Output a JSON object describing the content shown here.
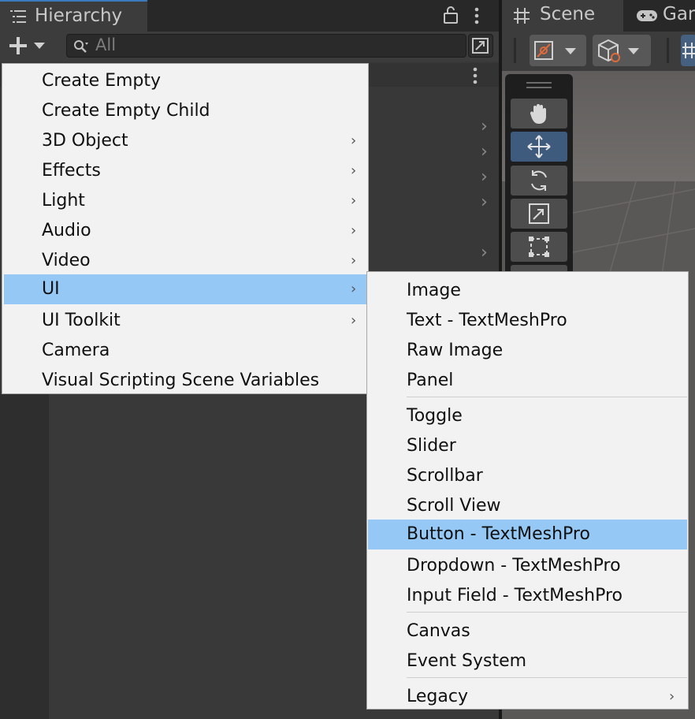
{
  "hierarchy": {
    "tab_title": "Hierarchy",
    "search_placeholder": "All"
  },
  "scene": {
    "tab_title": "Scene",
    "game_tab_title": "Gam"
  },
  "create_menu": {
    "items": [
      {
        "label": "Create Empty",
        "submenu": false
      },
      {
        "label": "Create Empty Child",
        "submenu": false
      },
      {
        "label": "3D Object",
        "submenu": true
      },
      {
        "label": "Effects",
        "submenu": true
      },
      {
        "label": "Light",
        "submenu": true
      },
      {
        "label": "Audio",
        "submenu": true
      },
      {
        "label": "Video",
        "submenu": true
      },
      {
        "label": "UI",
        "submenu": true,
        "highlighted": true
      },
      {
        "label": "UI Toolkit",
        "submenu": true
      },
      {
        "label": "Camera",
        "submenu": false
      },
      {
        "label": "Visual Scripting Scene Variables",
        "submenu": false
      }
    ]
  },
  "ui_submenu": {
    "items": [
      {
        "label": "Image"
      },
      {
        "label": "Text - TextMeshPro"
      },
      {
        "label": "Raw Image"
      },
      {
        "label": "Panel"
      },
      {
        "label": "Toggle"
      },
      {
        "label": "Slider"
      },
      {
        "label": "Scrollbar"
      },
      {
        "label": "Scroll View"
      },
      {
        "label": "Button - TextMeshPro",
        "highlighted": true
      },
      {
        "label": "Dropdown - TextMeshPro"
      },
      {
        "label": "Input Field - TextMeshPro"
      },
      {
        "label": "Canvas"
      },
      {
        "label": "Event System"
      },
      {
        "label": "Legacy",
        "submenu": true
      }
    ]
  },
  "colors": {
    "menu_background": "#f2f2f2",
    "highlight": "#95c8f5",
    "panel_background": "#383838",
    "active_tab_accent": "#3a79bb",
    "selected_tool": "#3e5b7e"
  }
}
